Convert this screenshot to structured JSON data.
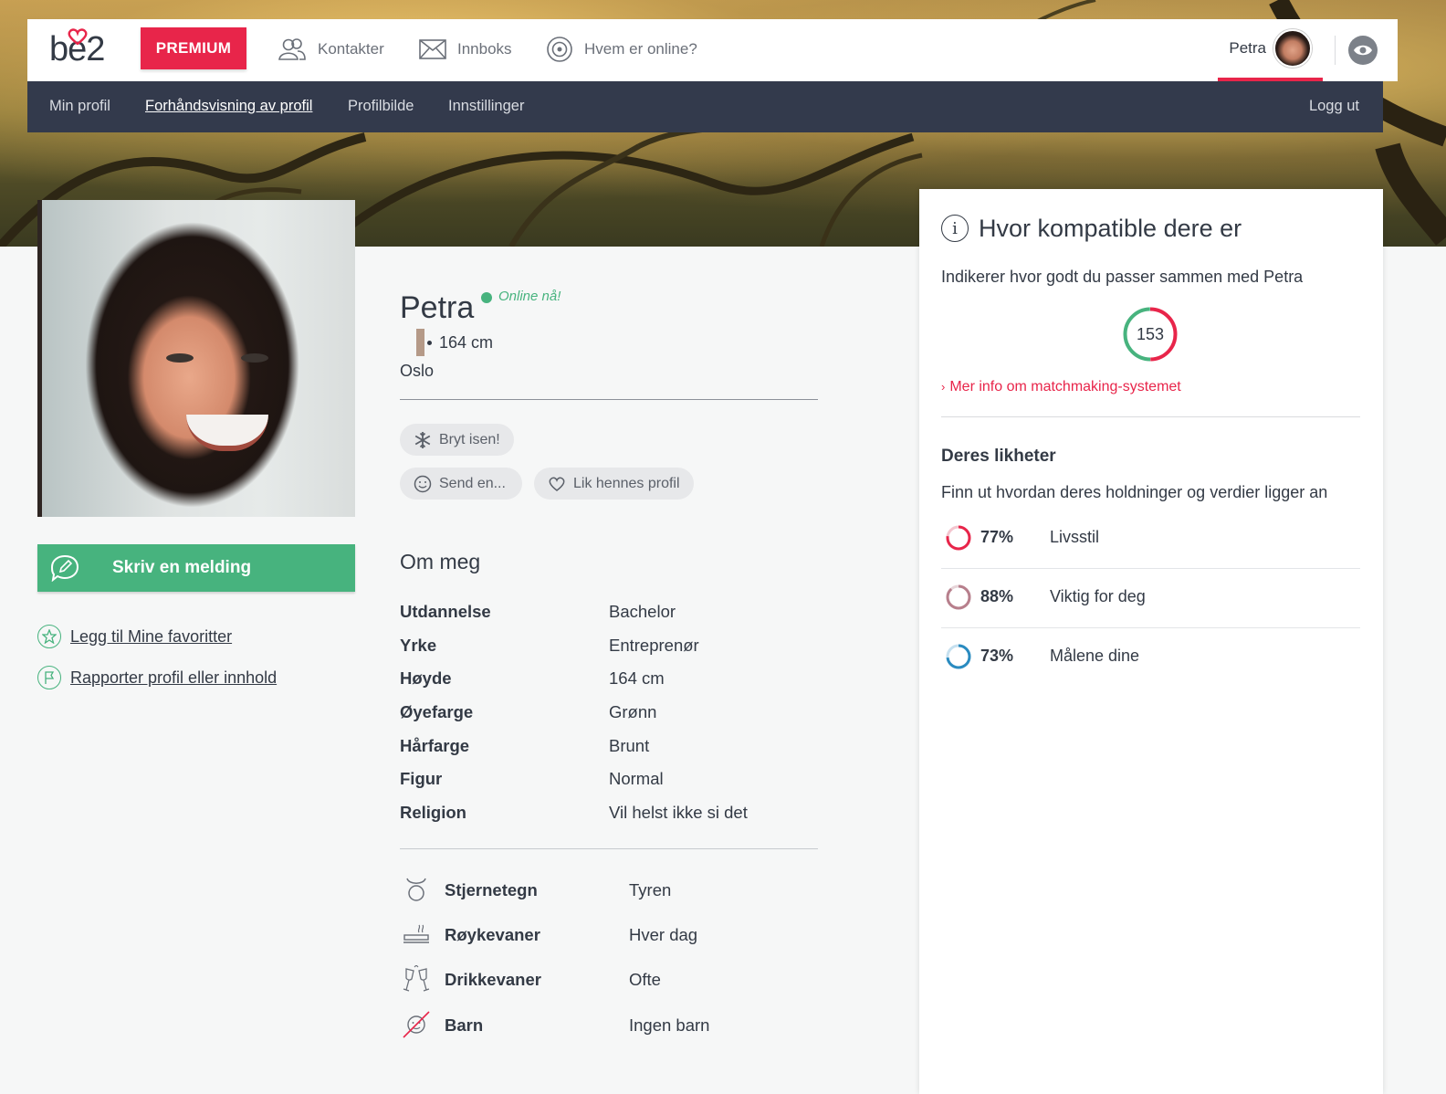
{
  "header": {
    "logo": "be2",
    "premium_label": "PREMIUM",
    "nav": [
      {
        "label": "Kontakter",
        "icon": "contacts-icon"
      },
      {
        "label": "Innboks",
        "icon": "envelope-icon"
      },
      {
        "label": "Hvem er online?",
        "icon": "online-radar-icon"
      }
    ],
    "user_name": "Petra"
  },
  "subnav": {
    "items": [
      "Min profil",
      "Forhåndsvisning av profil",
      "Profilbilde",
      "Innstillinger"
    ],
    "active": "Forhåndsvisning av profil",
    "logout": "Logg ut"
  },
  "profile": {
    "name": "Petra",
    "online_status": "Online nå!",
    "height": "164 cm",
    "city": "Oslo",
    "actions": {
      "write_message": "Skriv en melding",
      "add_favorite": "Legg til Mine favoritter",
      "report": "Rapporter profil eller innhold"
    },
    "pills": {
      "icebreaker": "Bryt isen!",
      "send": "Send en...",
      "like": "Lik hennes profil"
    }
  },
  "about": {
    "title": "Om meg",
    "attributes": [
      {
        "label": "Utdannelse",
        "value": "Bachelor"
      },
      {
        "label": "Yrke",
        "value": "Entreprenør"
      },
      {
        "label": "Høyde",
        "value": "164 cm"
      },
      {
        "label": "Øyefarge",
        "value": "Grønn"
      },
      {
        "label": "Hårfarge",
        "value": "Brunt"
      },
      {
        "label": "Figur",
        "value": "Normal"
      },
      {
        "label": "Religion",
        "value": "Vil helst ikke si det"
      }
    ],
    "habits": [
      {
        "label": "Stjernetegn",
        "value": "Tyren",
        "icon": "taurus-icon"
      },
      {
        "label": "Røykevaner",
        "value": "Hver dag",
        "icon": "cigarette-icon"
      },
      {
        "label": "Drikkevaner",
        "value": "Ofte",
        "icon": "champagne-glasses-icon"
      },
      {
        "label": "Barn",
        "value": "Ingen barn",
        "icon": "no-children-icon"
      }
    ]
  },
  "compatibility": {
    "title": "Hvor kompatible dere er",
    "subtitle": "Indikerer hvor godt du passer sammen med Petra",
    "score": "153",
    "more_info": "Mer info om matchmaking-systemet",
    "similarities_title": "Deres likheter",
    "similarities_sub": "Finn ut hvordan deres holdninger og verdier ligger an",
    "items": [
      {
        "pct": "77%",
        "label": "Livsstil",
        "value": 0.77,
        "color": "#e8254a"
      },
      {
        "pct": "88%",
        "label": "Viktig for deg",
        "value": 0.88,
        "color": "#b77f8c"
      },
      {
        "pct": "73%",
        "label": "Målene dine",
        "value": 0.73,
        "color": "#2a8bc0"
      }
    ]
  }
}
